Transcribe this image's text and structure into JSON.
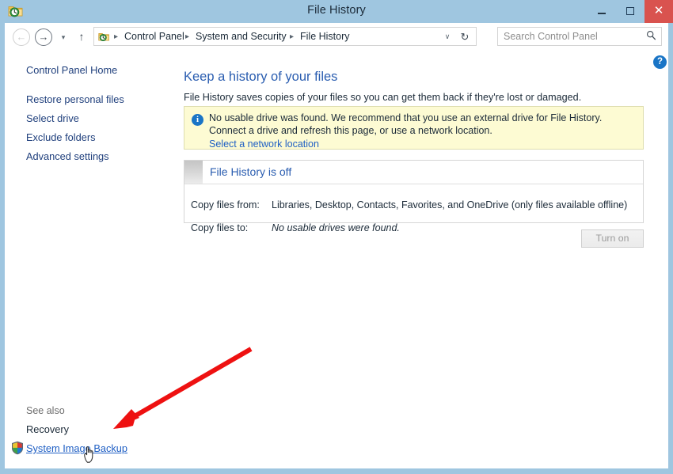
{
  "window": {
    "title": "File History",
    "icon": "file-history-icon",
    "controls": {
      "minimize": "–",
      "maximize": "□",
      "close": "✕"
    },
    "colors": {
      "titlebar": "#9fc6e0",
      "close_button": "#d9534f",
      "accent_link": "#1f5fc4",
      "heading": "#2a5db0",
      "banner_background": "#fdfbd3",
      "banner_border": "#dedeb0",
      "annotation_arrow": "#ee1111"
    }
  },
  "navbar": {
    "back_icon": "←",
    "forward_icon": "→",
    "recent_icon": "▾",
    "up_icon": "↑",
    "address_icon": "file-history-icon",
    "breadcrumbs": [
      "Control Panel",
      "System and Security",
      "File History"
    ],
    "breadcrumb_separator": "▸",
    "address_chevron": "∨",
    "refresh_icon": "↻",
    "search": {
      "placeholder": "Search Control Panel",
      "icon": "⌕"
    }
  },
  "help": {
    "icon_label": "?"
  },
  "sidebar": {
    "home_label": "Control Panel Home",
    "items": [
      {
        "label": "Restore personal files"
      },
      {
        "label": "Select drive"
      },
      {
        "label": "Exclude folders"
      },
      {
        "label": "Advanced settings"
      }
    ],
    "see_also": {
      "label": "See also",
      "items": [
        {
          "label": "Recovery"
        },
        {
          "label": "System Image Backup",
          "icon": "uac-shield-icon"
        }
      ]
    }
  },
  "main": {
    "page_title": "Keep a history of your files",
    "page_description": "File History saves copies of your files so you can get them back if they're lost or damaged.",
    "info_banner": {
      "icon": "info-icon",
      "text": "No usable drive was found. We recommend that you use an external drive for File History. Connect a drive and refresh this page, or use a network location.",
      "link": "Select a network location"
    },
    "status_panel": {
      "header": "File History is off",
      "rows": [
        {
          "label": "Copy files from:",
          "value": "Libraries, Desktop, Contacts, Favorites, and OneDrive (only files available offline)"
        },
        {
          "label": "Copy files to:",
          "value": "No usable drives were found."
        }
      ]
    },
    "turn_on_button": "Turn on"
  }
}
